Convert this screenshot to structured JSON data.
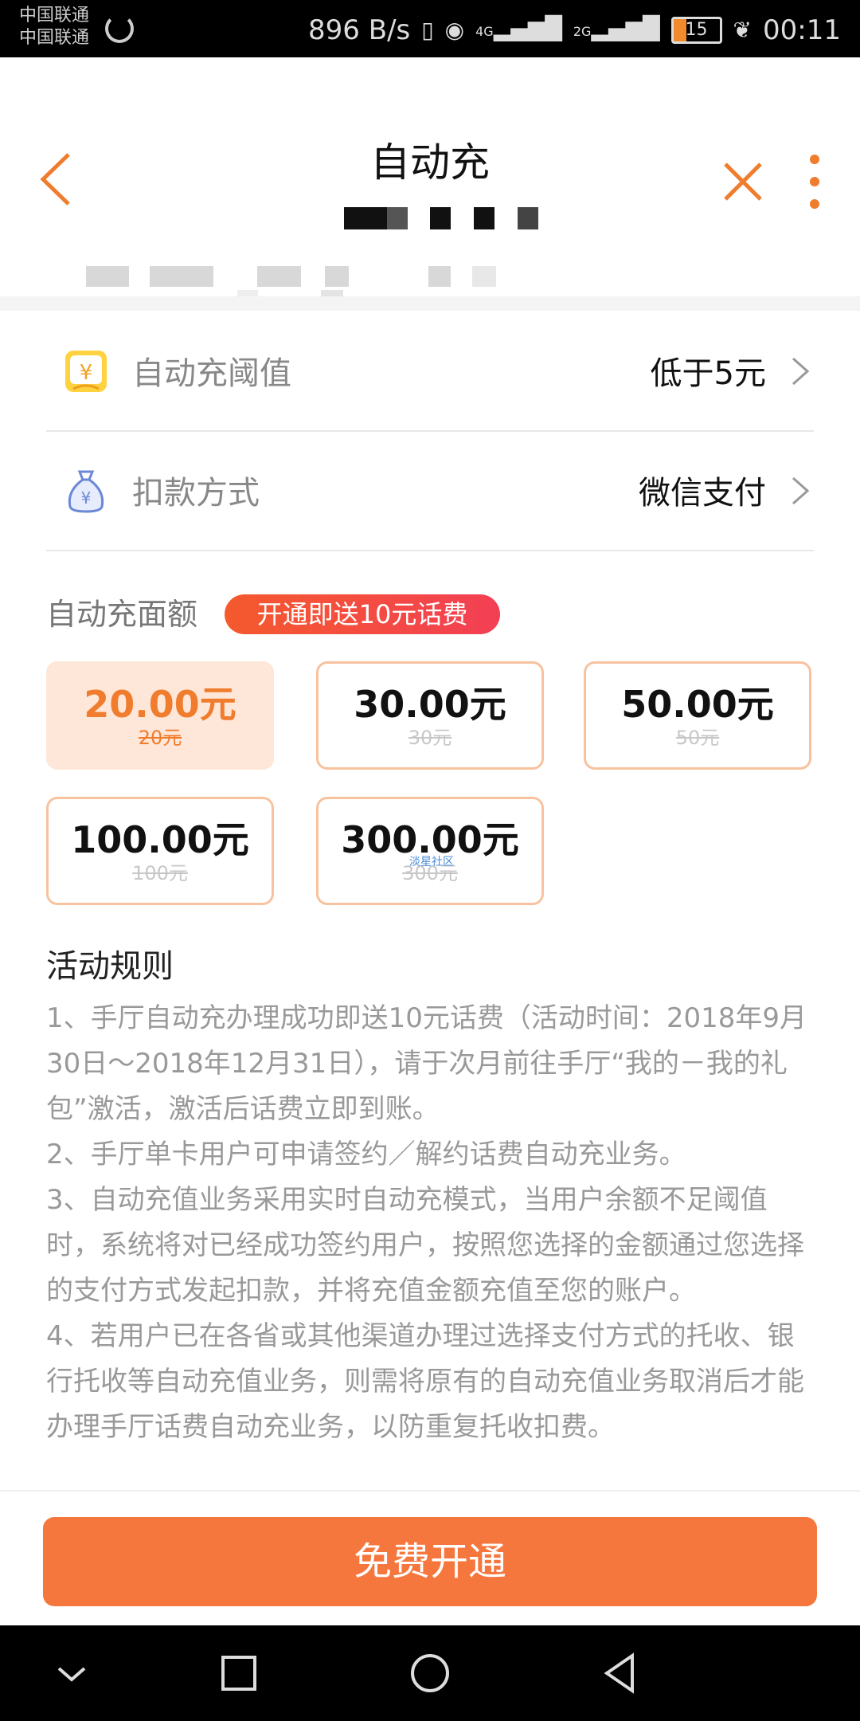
{
  "status_bar": {
    "carrier1": "中国联通",
    "carrier2": "中国联通",
    "speed": "896 B/s",
    "network1": "4G",
    "network2": "2G",
    "battery": "15",
    "time": "00:11"
  },
  "header": {
    "title": "自动充"
  },
  "settings": {
    "threshold_label": "自动充阈值",
    "threshold_value": "低于5元",
    "payment_label": "扣款方式",
    "payment_value": "微信支付"
  },
  "amounts_section": {
    "title": "自动充面额",
    "promo_badge": "开通即送10元话费",
    "options": [
      {
        "price": "20.00元",
        "original": "20元",
        "selected": true
      },
      {
        "price": "30.00元",
        "original": "30元",
        "selected": false
      },
      {
        "price": "50.00元",
        "original": "50元",
        "selected": false
      },
      {
        "price": "100.00元",
        "original": "100元",
        "selected": false
      },
      {
        "price": "300.00元",
        "original": "300元",
        "selected": false
      }
    ],
    "watermark": "淡星社区"
  },
  "rules": {
    "title": "活动规则",
    "items": [
      "1、手厅自动充办理成功即送10元话费（活动时间：2018年9月30日～2018年12月31日），请于次月前往手厅“我的－我的礼包”激活，激活后话费立即到账。",
      "2、手厅单卡用户可申请签约／解约话费自动充业务。",
      "3、自动充值业务采用实时自动充模式，当用户余额不足阈值时，系统将对已经成功签约用户，按照您选择的金额通过您选择的支付方式发起扣款，并将充值金额充值至您的账户。",
      "4、若用户已在各省或其他渠道办理过选择支付方式的托收、银行托收等自动充值业务，则需将原有的自动充值业务取消后才能办理手厅话费自动充业务，以防重复托收扣费。"
    ]
  },
  "cta": {
    "label": "免费开通"
  },
  "colors": {
    "accent": "#f6773d",
    "selected_bg": "#fee6d8",
    "card_border": "#f8c29f"
  }
}
